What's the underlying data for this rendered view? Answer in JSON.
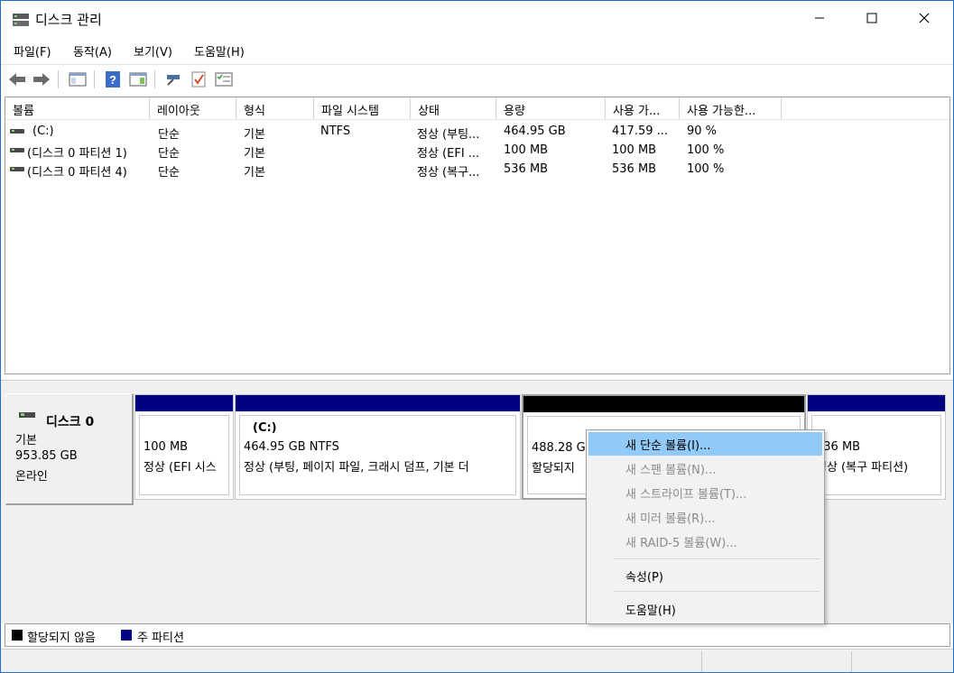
{
  "window": {
    "title": "디스크 관리",
    "minimize_label": "Minimize",
    "maximize_label": "Maximize",
    "close_label": "Close"
  },
  "menu": [
    "파일(F)",
    "동작(A)",
    "보기(V)",
    "도움말(H)"
  ],
  "toolbar": {
    "icons": [
      "back-arrow-icon",
      "forward-arrow-icon",
      "console-tree-icon",
      "help-icon",
      "action-pane-icon",
      "connect-icon",
      "check-icon",
      "properties-list-icon"
    ]
  },
  "volume_table": {
    "columns": [
      "볼륨",
      "레이아웃",
      "형식",
      "파일 시스템",
      "상태",
      "용량",
      "사용 가...",
      "사용 가능한..."
    ],
    "rows": [
      {
        "volume": "(C:)",
        "layout": "단순",
        "type": "기본",
        "fs": "NTFS",
        "status": "정상 (부팅...",
        "capacity": "464.95 GB",
        "free": "417.59 ...",
        "percent": "90 %"
      },
      {
        "volume": "(디스크 0 파티션 1)",
        "layout": "단순",
        "type": "기본",
        "fs": "",
        "status": "정상 (EFI ...",
        "capacity": "100 MB",
        "free": "100 MB",
        "percent": "100 %"
      },
      {
        "volume": "(디스크 0 파티션 4)",
        "layout": "단순",
        "type": "기본",
        "fs": "",
        "status": "정상 (복구...",
        "capacity": "536 MB",
        "free": "536 MB",
        "percent": "100 %"
      }
    ]
  },
  "disk": {
    "name": "디스크 0",
    "kind": "기본",
    "size": "953.85 GB",
    "state": "온라인",
    "partitions": [
      {
        "line1": "",
        "line2": "100 MB",
        "line3": "정상 (EFI 시스"
      },
      {
        "line1": "(C:)",
        "line2": "464.95 GB NTFS",
        "line3": "정상 (부팅, 페이지 파일, 크래시 덤프, 기본 더"
      },
      {
        "line1": "",
        "line2": "488.28 GI",
        "line3": "할당되지"
      },
      {
        "line1": "",
        "line2": "536 MB",
        "line3": "정상 (복구 파티션)"
      }
    ]
  },
  "legend": {
    "unallocated": "할당되지 않음",
    "primary": "주 파티션",
    "unallocated_color": "#000000",
    "primary_color": "#000080"
  },
  "context_menu": {
    "items": [
      {
        "label": "새 단순 볼륨(I)...",
        "enabled": true,
        "highlighted": true
      },
      {
        "label": "새 스팬 볼륨(N)...",
        "enabled": false
      },
      {
        "label": "새 스트라이프 볼륨(T)...",
        "enabled": false
      },
      {
        "label": "새 미러 볼륨(R)...",
        "enabled": false
      },
      {
        "label": "새 RAID-5 볼륨(W)...",
        "enabled": false
      },
      {
        "label": "속성(P)",
        "enabled": true
      },
      {
        "label": "도움말(H)",
        "enabled": true
      }
    ]
  },
  "colors": {
    "accent_blue": "#000080",
    "selection": "#91c9f7",
    "window_border": "#1e6ec8"
  }
}
